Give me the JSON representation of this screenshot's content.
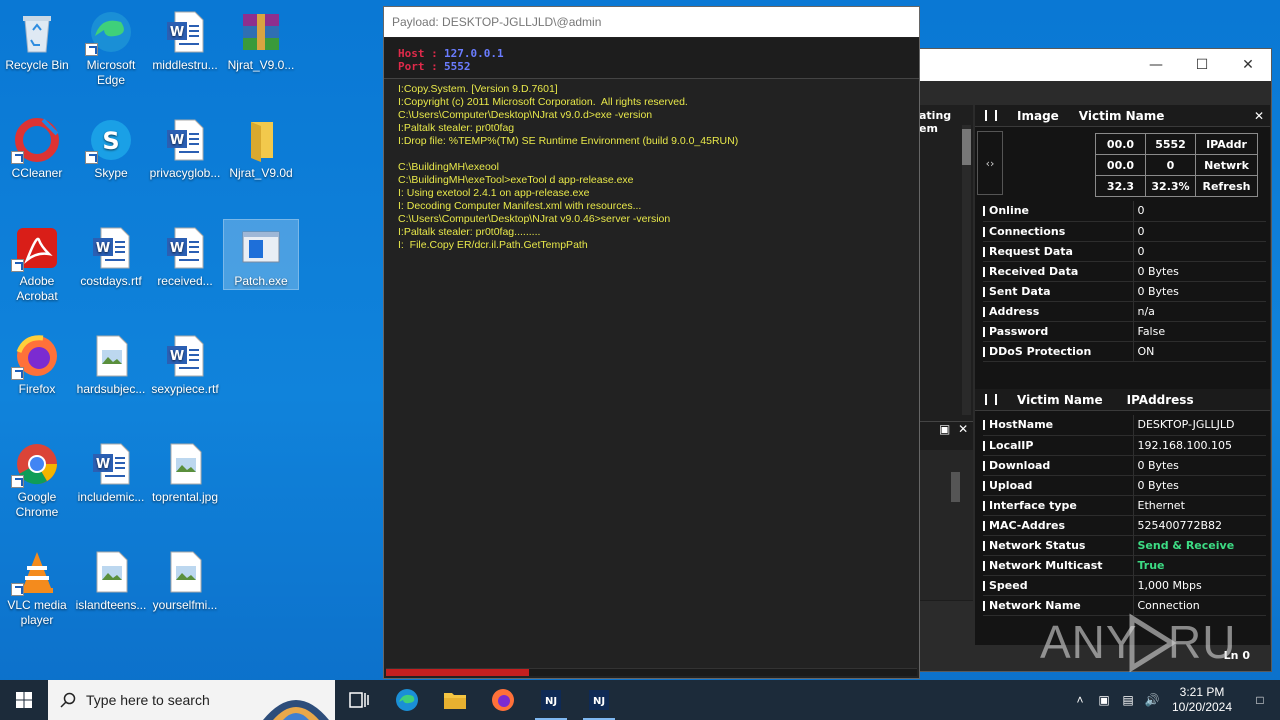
{
  "desktop": {
    "icons": [
      {
        "label": "Recycle Bin",
        "icon": "recycle-bin-icon"
      },
      {
        "label": "Microsoft Edge",
        "icon": "edge-icon"
      },
      {
        "label": "middlestru...",
        "icon": "word-doc-icon"
      },
      {
        "label": "Njrat_V9.0...",
        "icon": "winrar-archive-icon"
      },
      {
        "label": "CCleaner",
        "icon": "ccleaner-icon"
      },
      {
        "label": "Skype",
        "icon": "skype-icon"
      },
      {
        "label": "privacyglob...",
        "icon": "word-doc-icon"
      },
      {
        "label": "Njrat_V9.0d",
        "icon": "folder-icon"
      },
      {
        "label": "Adobe Acrobat",
        "icon": "acrobat-icon"
      },
      {
        "label": "costdays.rtf",
        "icon": "word-doc-icon"
      },
      {
        "label": "received...",
        "icon": "word-doc-icon"
      },
      {
        "label": "Patch.exe",
        "icon": "exe-window-icon"
      },
      {
        "label": "Firefox",
        "icon": "firefox-icon"
      },
      {
        "label": "hardsubjec...",
        "icon": "image-file-icon"
      },
      {
        "label": "sexypiece.rtf",
        "icon": "word-doc-icon"
      },
      {
        "label": "Google Chrome",
        "icon": "chrome-icon"
      },
      {
        "label": "includemic...",
        "icon": "word-doc-icon"
      },
      {
        "label": "toprental.jpg",
        "icon": "image-file-icon"
      },
      {
        "label": "VLC media player",
        "icon": "vlc-icon"
      },
      {
        "label": "islandteens...",
        "icon": "image-file-icon"
      },
      {
        "label": "yourselfmi...",
        "icon": "image-file-icon"
      }
    ]
  },
  "console": {
    "title": "Payload: DESKTOP-JGLLJLD\\@admin",
    "host_label": "Host :",
    "host_value": "127.0.0.1",
    "port_label": "Port :",
    "port_value": "5552",
    "log": [
      "I:Copy.System. [Version 9.D.7601]",
      "I:Copyright (c) 2011 Microsoft Corporation.  All rights reserved.",
      "C:\\Users\\Computer\\Desktop\\NJrat v9.0.d>exe -version",
      "I:Paltalk stealer: pr0t0fag",
      "I:Drop file: %TEMP%(TM) SE Runtime Environment (build 9.0.0_45RUN)",
      "",
      "C:\\BuildingMH\\exeool",
      "C:\\BuildingMH\\exeTool>exeTool d app-release.exe",
      "I: Using exetool 2.4.1 on app-release.exe",
      "I: Decoding Computer Manifest.xml with resources...",
      "C:\\Users\\Computer\\Desktop\\NJrat v9.0.46>server -version",
      "I:Paltalk stealer: pr0t0fag.........",
      "I:  File.Copy ER/dcr.il.Path.GetTempPath"
    ],
    "progress": 0.27
  },
  "mainwin": {
    "side_text": [
      "ating",
      "em"
    ],
    "header1": {
      "col1": "Image",
      "col2": "Victim Name"
    },
    "stats": [
      [
        "00.0",
        "5552",
        "IPAddr"
      ],
      [
        "00.0",
        "0",
        "Netwrk"
      ],
      [
        "32.3",
        "32.3%",
        "Refresh"
      ]
    ],
    "info1": [
      {
        "k": "Online",
        "v": "0"
      },
      {
        "k": "Connections",
        "v": "0"
      },
      {
        "k": "Request Data",
        "v": "0"
      },
      {
        "k": "Received Data",
        "v": "0 Bytes"
      },
      {
        "k": "Sent Data",
        "v": "0 Bytes"
      },
      {
        "k": "Address",
        "v": "n/a"
      },
      {
        "k": "Password",
        "v": "False"
      },
      {
        "k": "DDoS Protection",
        "v": "ON"
      }
    ],
    "header2": {
      "col1": "Victim Name",
      "col2": "IPAddress"
    },
    "info2": [
      {
        "k": "HostName",
        "v": "DESKTOP-JGLLJLD"
      },
      {
        "k": "LocalIP",
        "v": "192.168.100.105"
      },
      {
        "k": "Download",
        "v": "0 Bytes"
      },
      {
        "k": "Upload",
        "v": "0 Bytes"
      },
      {
        "k": "Interface type",
        "v": "Ethernet"
      },
      {
        "k": "MAC-Addres",
        "v": "525400772B82"
      },
      {
        "k": "Network Status",
        "v": "Send & Receive"
      },
      {
        "k": "Network Multicast",
        "v": "True"
      },
      {
        "k": "Speed",
        "v": "1,000 Mbps"
      },
      {
        "k": "Network Name",
        "v": "Connection"
      }
    ],
    "status_right": "Ln  0"
  },
  "taskbar": {
    "search_placeholder": "Type here to search",
    "time": "3:21 PM",
    "date": "10/20/2024"
  },
  "watermark": "ANY RUN"
}
